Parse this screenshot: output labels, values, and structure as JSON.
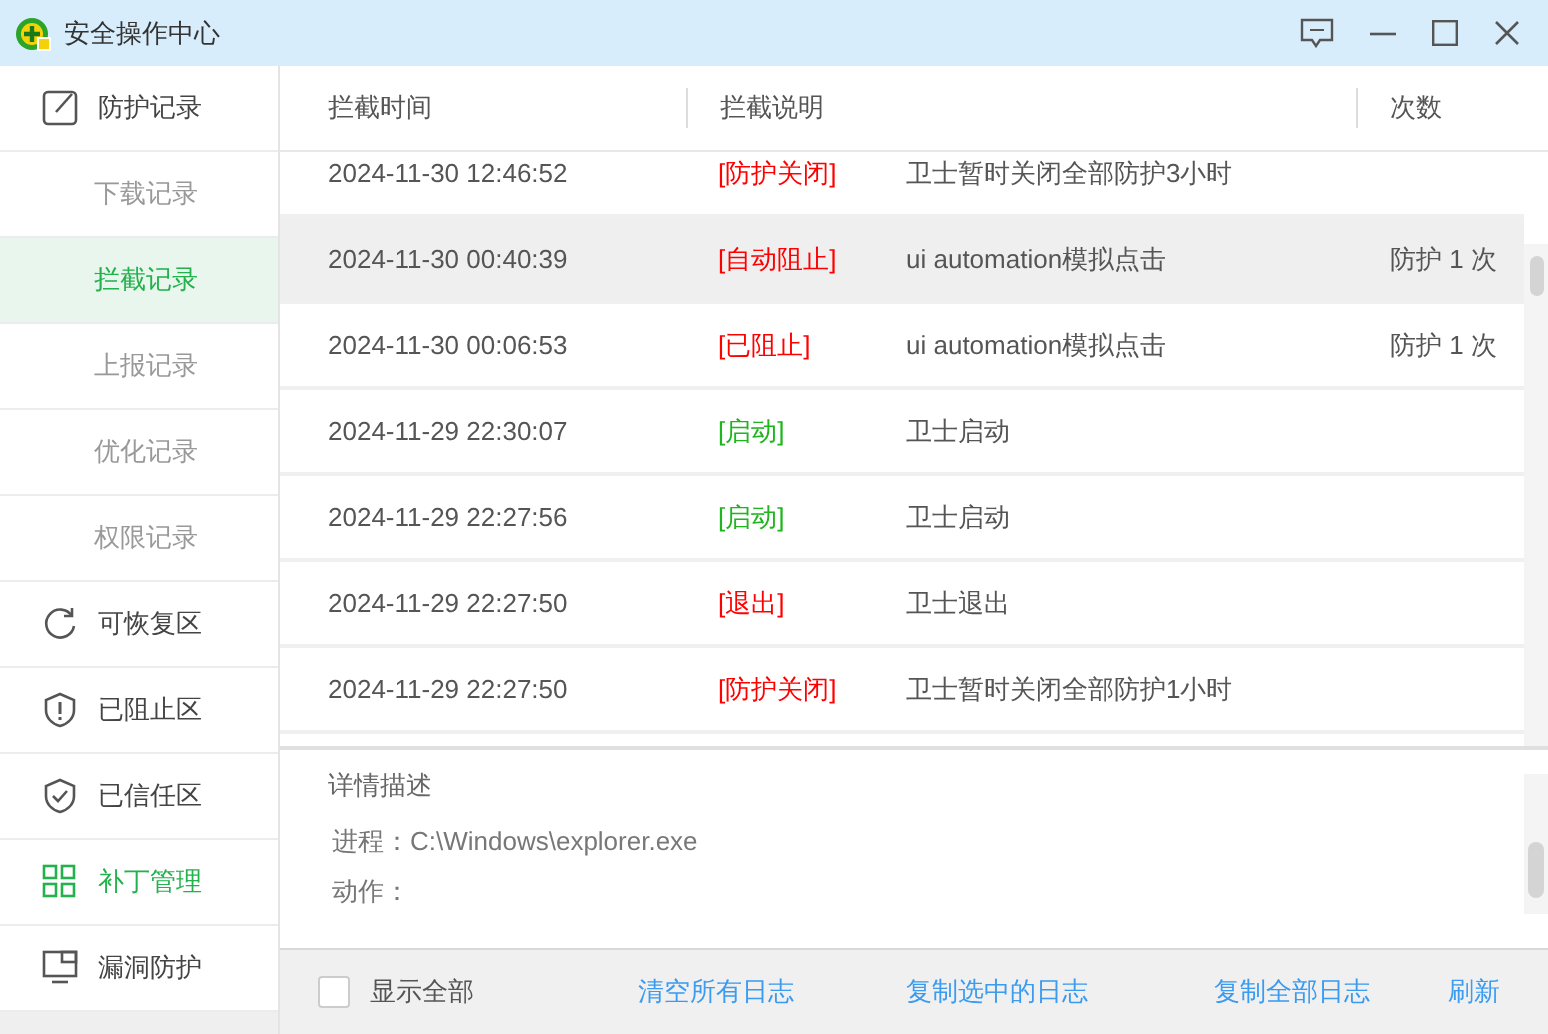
{
  "window": {
    "title": "安全操作中心"
  },
  "sidebar": {
    "items": [
      {
        "label": "防护记录",
        "kind": "edit",
        "highlighted": false,
        "children": [
          {
            "label": "下载记录",
            "selected": false
          },
          {
            "label": "拦截记录",
            "selected": true
          },
          {
            "label": "上报记录",
            "selected": false
          },
          {
            "label": "优化记录",
            "selected": false
          },
          {
            "label": "权限记录",
            "selected": false
          }
        ]
      },
      {
        "label": "可恢复区",
        "kind": "restore",
        "highlighted": false
      },
      {
        "label": "已阻止区",
        "kind": "blocked",
        "highlighted": false
      },
      {
        "label": "已信任区",
        "kind": "trusted",
        "highlighted": false
      },
      {
        "label": "补丁管理",
        "kind": "patch",
        "highlighted": true
      },
      {
        "label": "漏洞防护",
        "kind": "vulnerability",
        "highlighted": false
      }
    ]
  },
  "table": {
    "columns": [
      "拦截时间",
      "拦截说明",
      "次数"
    ],
    "rows": [
      {
        "time": "2024-11-30 12:46:52",
        "tag": "[防护关闭]",
        "color": "#ff0000",
        "description": "卫士暂时关闭全部防护3小时",
        "selected": false
      },
      {
        "time": "2024-11-30 00:40:39",
        "tag": "[自动阻止]",
        "color": "#ff0000",
        "description": "ui automation模拟点击",
        "count": "防护 1 次",
        "selected": true
      },
      {
        "time": "2024-11-30 00:06:53",
        "tag": "[已阻止]",
        "color": "#ff0000",
        "description": "ui automation模拟点击",
        "count": "防护 1 次",
        "selected": false
      },
      {
        "time": "2024-11-29 22:30:07",
        "tag": "[启动]",
        "color": "#1fb51f",
        "description": "卫士启动",
        "selected": false
      },
      {
        "time": "2024-11-29 22:27:56",
        "tag": "[启动]",
        "color": "#1fb51f",
        "description": "卫士启动",
        "selected": false
      },
      {
        "time": "2024-11-29 22:27:50",
        "tag": "[退出]",
        "color": "#ff0000",
        "description": "卫士退出",
        "selected": false
      },
      {
        "time": "2024-11-29 22:27:50",
        "tag": "[防护关闭]",
        "color": "#ff0000",
        "description": "卫士暂时关闭全部防护1小时",
        "selected": false
      }
    ]
  },
  "details": {
    "title": "详情描述",
    "lines": [
      "进程：C:\\Windows\\explorer.exe",
      "动作："
    ]
  },
  "footer": {
    "show_all": {
      "label": "显示全部",
      "checked": false
    },
    "links": [
      "清空所有日志",
      "复制选中的日志",
      "复制全部日志",
      "刷新"
    ]
  }
}
